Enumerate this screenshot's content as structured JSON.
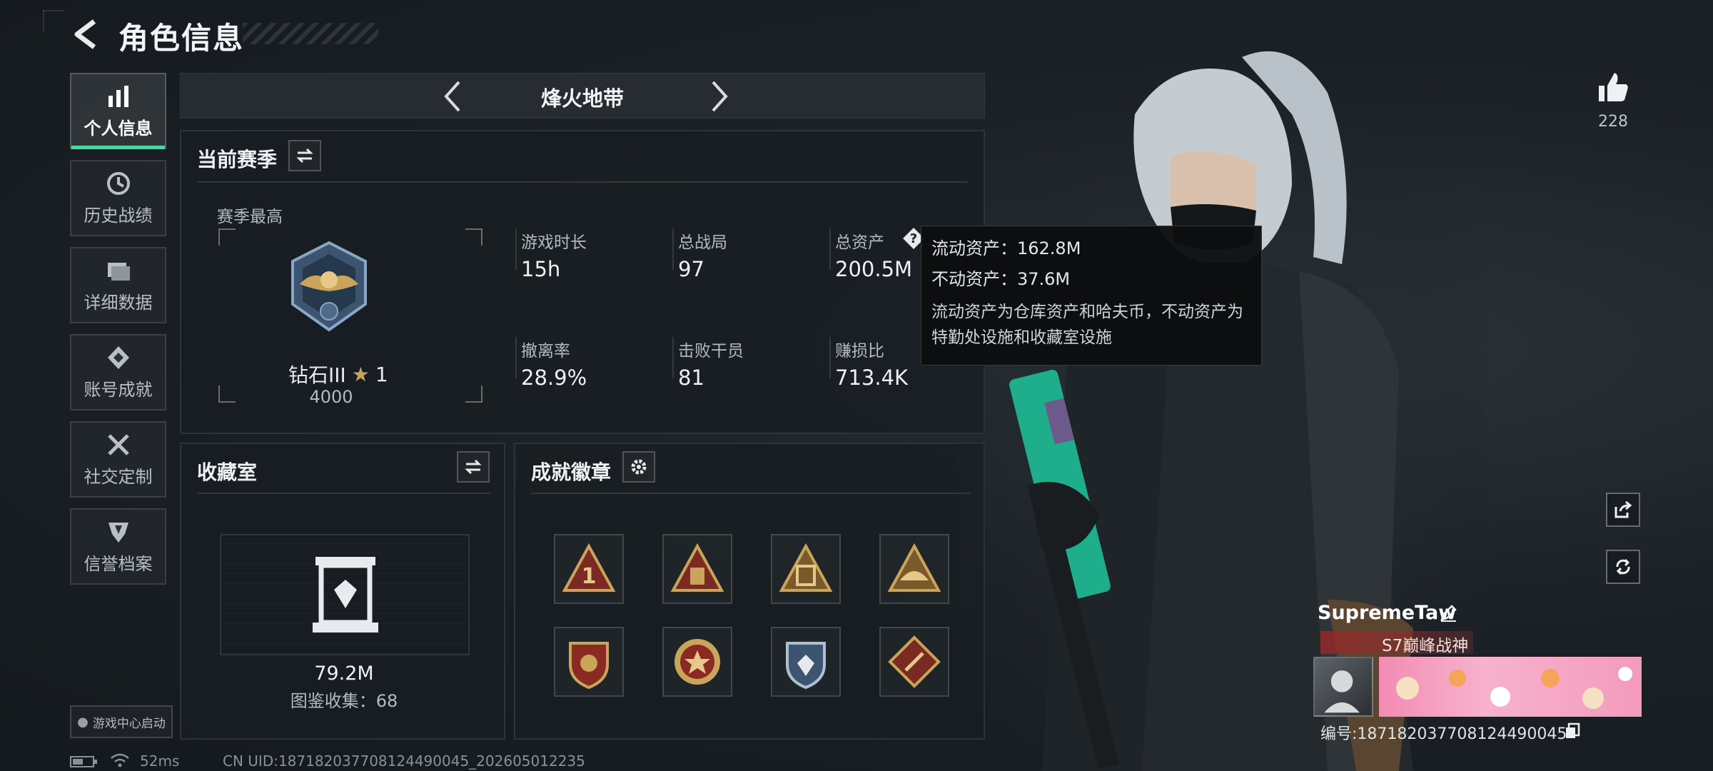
{
  "header": {
    "title": "角色信息"
  },
  "sidebar": {
    "items": [
      {
        "label": "个人信息",
        "icon": "bar-chart-icon",
        "active": true
      },
      {
        "label": "历史战绩",
        "icon": "clock-icon",
        "active": false
      },
      {
        "label": "详细数据",
        "icon": "folder-icon",
        "active": false
      },
      {
        "label": "账号成就",
        "icon": "diamond-badge-icon",
        "active": false
      },
      {
        "label": "社交定制",
        "icon": "tools-icon",
        "active": false
      },
      {
        "label": "信誉档案",
        "icon": "shield-icon",
        "active": false
      }
    ],
    "game_center": "游戏中心启动"
  },
  "mode": {
    "name": "烽火地带"
  },
  "season": {
    "title": "当前赛季",
    "best_label": "赛季最高",
    "rank": "钻石III",
    "stars": "1",
    "score": "4000",
    "stats": [
      {
        "label": "游戏时长",
        "value": "15h"
      },
      {
        "label": "总战局",
        "value": "97"
      },
      {
        "label": "总资产",
        "value": "200.5M"
      },
      {
        "label": "撤离率",
        "value": "28.9%"
      },
      {
        "label": "击败干员",
        "value": "81"
      },
      {
        "label": "赚损比",
        "value": "713.4K"
      }
    ]
  },
  "tooltip": {
    "liquid": "流动资产：162.8M",
    "fixed": "不动资产：37.6M",
    "description": "流动资产为仓库资产和哈夫币，不动资产为特勤处设施和收藏室设施"
  },
  "collection": {
    "title": "收藏室",
    "value": "79.2M",
    "catalog": "图鉴收集：68"
  },
  "achievements": {
    "title": "成就徽章",
    "badges": [
      "badge-1-icon",
      "badge-2-icon",
      "badge-3-icon",
      "badge-4-icon",
      "badge-5-icon",
      "badge-6-icon",
      "badge-7-icon",
      "badge-8-icon"
    ]
  },
  "profile": {
    "likes": "228",
    "name": "SupremeTaw",
    "title_tag": "S7巅峰战神",
    "uid": "编号:18718203770812449004​5"
  },
  "status": {
    "ping": "52ms",
    "uid_line": "CN UID:187182037708124490045_202605012235"
  },
  "colors": {
    "accent_green": "#4fd6a0",
    "rank_gold": "#c9a45a",
    "badge_red": "#8a2a22"
  }
}
